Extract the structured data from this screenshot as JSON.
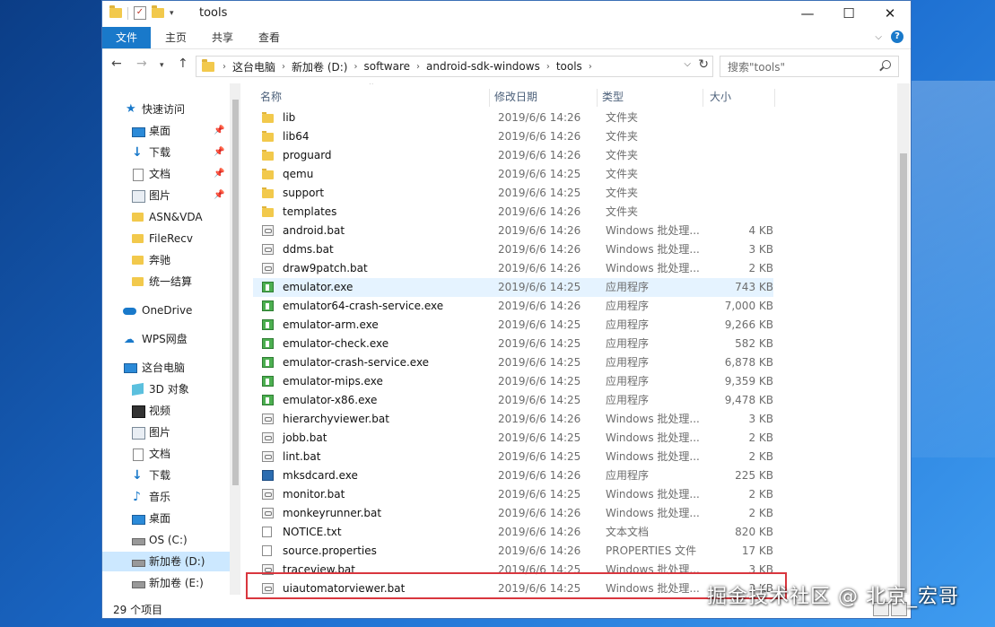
{
  "window": {
    "title": "tools",
    "controls": {
      "minimize": "—",
      "maximize": "☐",
      "close": "✕"
    }
  },
  "ribbon": {
    "tabs": [
      "文件",
      "主页",
      "共享",
      "查看"
    ]
  },
  "address": {
    "crumbs": [
      "这台电脑",
      "新加卷 (D:)",
      "software",
      "android-sdk-windows",
      "tools"
    ]
  },
  "search": {
    "placeholder": "搜索\"tools\""
  },
  "nav": {
    "items": [
      {
        "label": "快速访问",
        "icon": "star-icon",
        "pinned": false
      },
      {
        "label": "桌面",
        "icon": "desktop-icon",
        "pinned": true
      },
      {
        "label": "下载",
        "icon": "download-icon",
        "pinned": true
      },
      {
        "label": "文档",
        "icon": "document-icon",
        "pinned": true
      },
      {
        "label": "图片",
        "icon": "pictures-icon",
        "pinned": true
      },
      {
        "label": "ASN&VDA",
        "icon": "folder-icon",
        "pinned": false
      },
      {
        "label": "FileRecv",
        "icon": "folder-icon",
        "pinned": false
      },
      {
        "label": "奔驰",
        "icon": "folder-icon",
        "pinned": false
      },
      {
        "label": "统一结算",
        "icon": "folder-icon",
        "pinned": false
      },
      {
        "label": "OneDrive",
        "icon": "cloud-icon",
        "pinned": false
      },
      {
        "label": "WPS网盘",
        "icon": "wps-cloud-icon",
        "pinned": false
      },
      {
        "label": "这台电脑",
        "icon": "computer-icon",
        "pinned": false
      },
      {
        "label": "3D 对象",
        "icon": "3d-objects-icon",
        "pinned": false
      },
      {
        "label": "视频",
        "icon": "video-icon",
        "pinned": false
      },
      {
        "label": "图片",
        "icon": "pictures-icon",
        "pinned": false
      },
      {
        "label": "文档",
        "icon": "document-icon",
        "pinned": false
      },
      {
        "label": "下载",
        "icon": "download-icon",
        "pinned": false
      },
      {
        "label": "音乐",
        "icon": "music-icon",
        "pinned": false
      },
      {
        "label": "桌面",
        "icon": "desktop-icon",
        "pinned": false
      },
      {
        "label": "OS (C:)",
        "icon": "drive-icon",
        "pinned": false
      },
      {
        "label": "新加卷 (D:)",
        "icon": "drive-icon",
        "pinned": false,
        "selected": true
      },
      {
        "label": "新加卷 (E:)",
        "icon": "drive-icon",
        "pinned": false
      }
    ]
  },
  "columns": {
    "name": "名称",
    "date": "修改日期",
    "type": "类型",
    "size": "大小"
  },
  "files": [
    {
      "name": "lib",
      "date": "2019/6/6 14:26",
      "type": "文件夹",
      "size": "",
      "kind": "folder"
    },
    {
      "name": "lib64",
      "date": "2019/6/6 14:26",
      "type": "文件夹",
      "size": "",
      "kind": "folder"
    },
    {
      "name": "proguard",
      "date": "2019/6/6 14:26",
      "type": "文件夹",
      "size": "",
      "kind": "folder"
    },
    {
      "name": "qemu",
      "date": "2019/6/6 14:25",
      "type": "文件夹",
      "size": "",
      "kind": "folder"
    },
    {
      "name": "support",
      "date": "2019/6/6 14:25",
      "type": "文件夹",
      "size": "",
      "kind": "folder"
    },
    {
      "name": "templates",
      "date": "2019/6/6 14:26",
      "type": "文件夹",
      "size": "",
      "kind": "folder"
    },
    {
      "name": "android.bat",
      "date": "2019/6/6 14:26",
      "type": "Windows 批处理...",
      "size": "4 KB",
      "kind": "bat"
    },
    {
      "name": "ddms.bat",
      "date": "2019/6/6 14:26",
      "type": "Windows 批处理...",
      "size": "3 KB",
      "kind": "bat"
    },
    {
      "name": "draw9patch.bat",
      "date": "2019/6/6 14:26",
      "type": "Windows 批处理...",
      "size": "2 KB",
      "kind": "bat"
    },
    {
      "name": "emulator.exe",
      "date": "2019/6/6 14:25",
      "type": "应用程序",
      "size": "743 KB",
      "kind": "exe",
      "hover": true
    },
    {
      "name": "emulator64-crash-service.exe",
      "date": "2019/6/6 14:26",
      "type": "应用程序",
      "size": "7,000 KB",
      "kind": "exe"
    },
    {
      "name": "emulator-arm.exe",
      "date": "2019/6/6 14:25",
      "type": "应用程序",
      "size": "9,266 KB",
      "kind": "exe"
    },
    {
      "name": "emulator-check.exe",
      "date": "2019/6/6 14:25",
      "type": "应用程序",
      "size": "582 KB",
      "kind": "exe"
    },
    {
      "name": "emulator-crash-service.exe",
      "date": "2019/6/6 14:25",
      "type": "应用程序",
      "size": "6,878 KB",
      "kind": "exe"
    },
    {
      "name": "emulator-mips.exe",
      "date": "2019/6/6 14:25",
      "type": "应用程序",
      "size": "9,359 KB",
      "kind": "exe"
    },
    {
      "name": "emulator-x86.exe",
      "date": "2019/6/6 14:25",
      "type": "应用程序",
      "size": "9,478 KB",
      "kind": "exe"
    },
    {
      "name": "hierarchyviewer.bat",
      "date": "2019/6/6 14:26",
      "type": "Windows 批处理...",
      "size": "3 KB",
      "kind": "bat"
    },
    {
      "name": "jobb.bat",
      "date": "2019/6/6 14:25",
      "type": "Windows 批处理...",
      "size": "2 KB",
      "kind": "bat"
    },
    {
      "name": "lint.bat",
      "date": "2019/6/6 14:25",
      "type": "Windows 批处理...",
      "size": "2 KB",
      "kind": "bat"
    },
    {
      "name": "mksdcard.exe",
      "date": "2019/6/6 14:26",
      "type": "应用程序",
      "size": "225 KB",
      "kind": "exe2"
    },
    {
      "name": "monitor.bat",
      "date": "2019/6/6 14:25",
      "type": "Windows 批处理...",
      "size": "2 KB",
      "kind": "bat"
    },
    {
      "name": "monkeyrunner.bat",
      "date": "2019/6/6 14:26",
      "type": "Windows 批处理...",
      "size": "2 KB",
      "kind": "bat"
    },
    {
      "name": "NOTICE.txt",
      "date": "2019/6/6 14:26",
      "type": "文本文档",
      "size": "820 KB",
      "kind": "txt"
    },
    {
      "name": "source.properties",
      "date": "2019/6/6 14:26",
      "type": "PROPERTIES 文件",
      "size": "17 KB",
      "kind": "txt"
    },
    {
      "name": "traceview.bat",
      "date": "2019/6/6 14:25",
      "type": "Windows 批处理...",
      "size": "3 KB",
      "kind": "bat"
    },
    {
      "name": "uiautomatorviewer.bat",
      "date": "2019/6/6 14:25",
      "type": "Windows 批处理...",
      "size": "3 KB",
      "kind": "bat"
    }
  ],
  "status": {
    "count": "29 个项目"
  },
  "watermark": "掘金技术社区 @ 北京_宏哥",
  "colors": {
    "accent": "#1979ca",
    "highlight": "#d9363e",
    "hover": "#e5f3ff",
    "selected": "#cce8ff"
  }
}
